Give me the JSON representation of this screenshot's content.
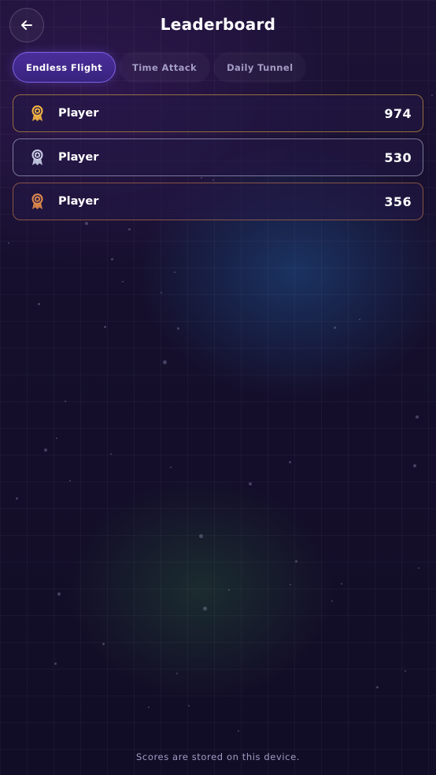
{
  "header": {
    "title": "Leaderboard",
    "back_icon": "arrow-left-icon"
  },
  "tabs": [
    {
      "label": "Endless Flight",
      "active": true
    },
    {
      "label": "Time Attack",
      "active": false
    },
    {
      "label": "Daily Tunnel",
      "active": false
    }
  ],
  "leaderboard": [
    {
      "rank": 1,
      "name": "Player",
      "score": "974",
      "medal": "gold-medal-icon",
      "color": "#f5b642"
    },
    {
      "rank": 2,
      "name": "Player",
      "score": "530",
      "medal": "silver-medal-icon",
      "color": "#c9cde6"
    },
    {
      "rank": 3,
      "name": "Player",
      "score": "356",
      "medal": "bronze-medal-icon",
      "color": "#e08a4a"
    }
  ],
  "footer": {
    "note": "Scores are stored on this device."
  },
  "colors": {
    "accent": "#7f62e6",
    "gold": "#f5b642",
    "silver": "#c9cde6",
    "bronze": "#e08a4a",
    "muted_text": "#a39cc4"
  }
}
